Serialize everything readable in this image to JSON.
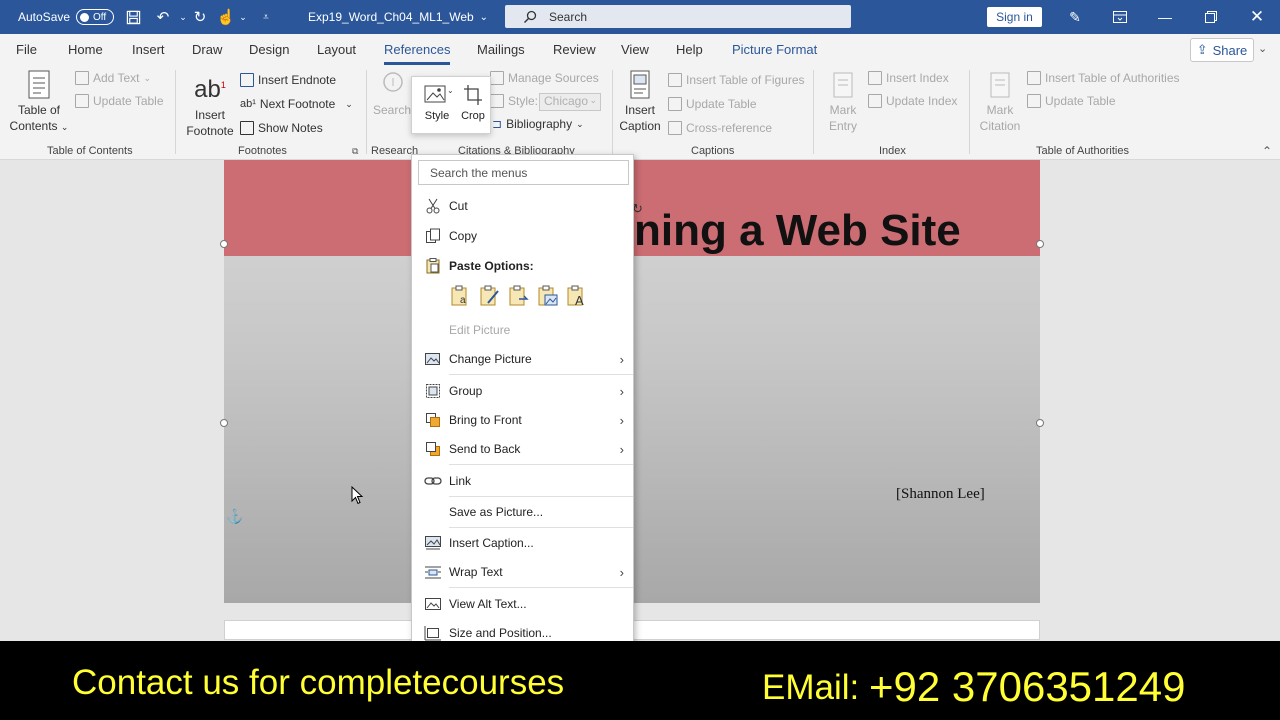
{
  "titlebar": {
    "autosave_label": "AutoSave",
    "autosave_state": "Off",
    "doc_title": "Exp19_Word_Ch04_ML1_Web",
    "search_placeholder": "Search",
    "signin_label": "Sign in"
  },
  "tabs": [
    {
      "label": "File"
    },
    {
      "label": "Home"
    },
    {
      "label": "Insert"
    },
    {
      "label": "Draw"
    },
    {
      "label": "Design"
    },
    {
      "label": "Layout"
    },
    {
      "label": "References"
    },
    {
      "label": "Mailings"
    },
    {
      "label": "Review"
    },
    {
      "label": "View"
    },
    {
      "label": "Help"
    },
    {
      "label": "Picture Format"
    }
  ],
  "share_label": "Share",
  "ribbon": {
    "toc": {
      "table_of_contents": [
        "Table of",
        "Contents"
      ],
      "add_text": "Add Text",
      "update_table": "Update Table",
      "group": "Table of Contents"
    },
    "footnotes": {
      "insert_footnote": [
        "Insert",
        "Footnote"
      ],
      "insert_endnote": "Insert Endnote",
      "next_footnote": "Next Footnote",
      "show_notes": "Show Notes",
      "group": "Footnotes"
    },
    "research": {
      "search": "Search",
      "group": "Research"
    },
    "citations": {
      "manage_sources": "Manage Sources",
      "style_label": "Style:",
      "style_value": "Chicago",
      "bibliography": "Bibliography",
      "group": "Citations & Bibliography"
    },
    "captions": {
      "insert_caption": [
        "Insert",
        "Caption"
      ],
      "insert_table_of_figures": "Insert Table of Figures",
      "update_table": "Update Table",
      "cross_reference": "Cross-reference",
      "group": "Captions"
    },
    "index": {
      "mark_entry": [
        "Mark",
        "Entry"
      ],
      "insert_index": "Insert Index",
      "update_index": "Update Index",
      "group": "Index"
    },
    "authorities": {
      "mark_citation": [
        "Mark",
        "Citation"
      ],
      "insert_table_of_authorities": "Insert Table of Authorities",
      "update_table": "Update Table",
      "group": "Table of Authorities"
    }
  },
  "mini_toolbar": {
    "style": "Style",
    "crop": "Crop"
  },
  "document": {
    "heading": "ning a Web Site",
    "author": "Shannon Lee"
  },
  "context_menu": {
    "search_placeholder": "Search the menus",
    "items": [
      {
        "label": "Cut",
        "icon": "scissors-icon"
      },
      {
        "label": "Copy",
        "icon": "copy-icon"
      },
      {
        "label": "Paste Options:",
        "icon": "paste-icon"
      },
      {
        "label": "Edit Picture",
        "icon": ""
      },
      {
        "label": "Change Picture",
        "icon": "change-picture-icon"
      },
      {
        "label": "Group",
        "icon": "group-icon"
      },
      {
        "label": "Bring to Front",
        "icon": "bring-to-front-icon"
      },
      {
        "label": "Send to Back",
        "icon": "send-to-back-icon"
      },
      {
        "label": "Link",
        "icon": "link-icon"
      },
      {
        "label": "Save as Picture...",
        "icon": ""
      },
      {
        "label": "Insert Caption...",
        "icon": "insert-caption-icon"
      },
      {
        "label": "Wrap Text",
        "icon": "wrap-text-icon"
      },
      {
        "label": "View Alt Text...",
        "icon": "alt-text-icon"
      },
      {
        "label": "Size and Position...",
        "icon": "size-position-icon"
      }
    ]
  },
  "promo": {
    "left": "Contact us for completecourses",
    "right_label": "EMail: ",
    "right_number": "+92 3706351249"
  },
  "colors": {
    "titlebar": "#2b579a",
    "banner": "#cb6d73",
    "promo_text": "#ffff33"
  }
}
